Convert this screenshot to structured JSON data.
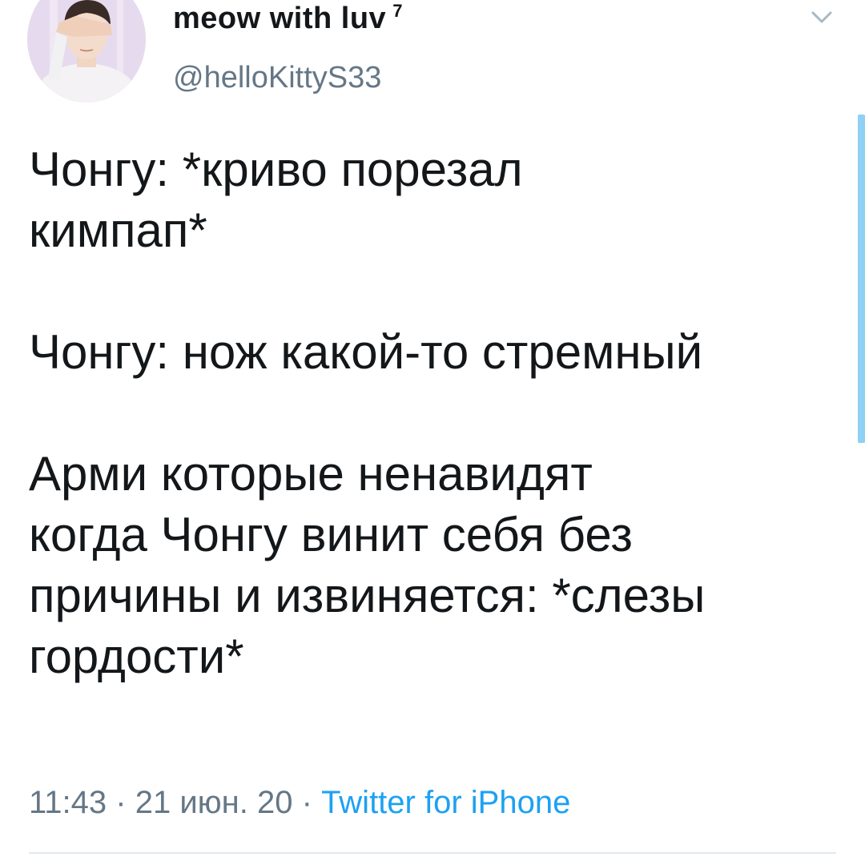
{
  "author": {
    "display_name": "meow with luv",
    "superscript": "7",
    "handle": "@helloKittyS33"
  },
  "tweet": {
    "paragraphs": [
      "Чонгу: *криво порезал\nкимпап*",
      "Чонгу: нож какой-то стремный",
      "Арми которые ненавидят\nкогда Чонгу винит себя без\nпричины и извиняется: *слезы\nгордости*"
    ]
  },
  "meta": {
    "time": "11:43",
    "separator": "·",
    "date": "21 июн. 20",
    "source": "Twitter for iPhone"
  },
  "icons": {
    "menu": "chevron-down-icon",
    "avatar": "avatar"
  },
  "colors": {
    "text": "#14171a",
    "secondary": "#657786",
    "link": "#1da1f2",
    "scrollbar": "#8fd0f5"
  }
}
